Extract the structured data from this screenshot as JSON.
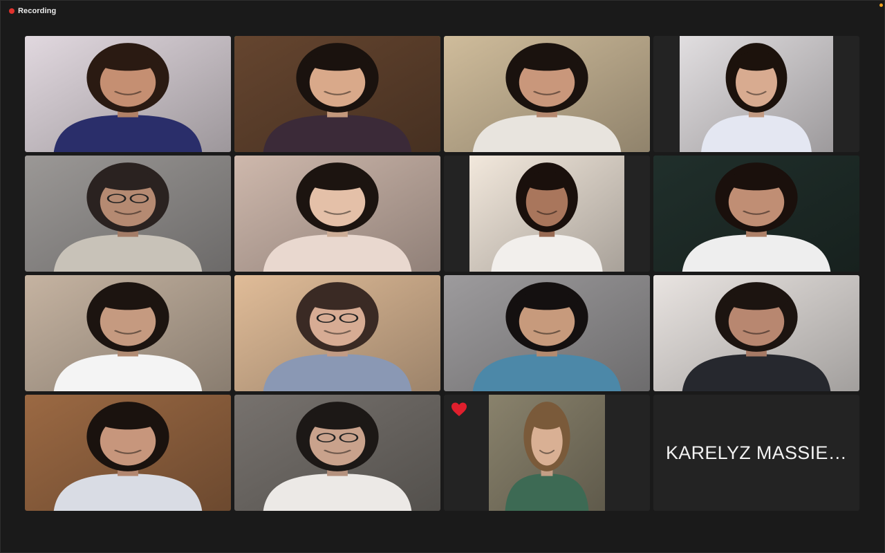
{
  "meeting": {
    "recording_label": "Recording",
    "recording_color": "#e0322d",
    "active_speaker_color": "#36c24a"
  },
  "participants": [
    {
      "video": true,
      "active": false,
      "bg": "#c9c1c7",
      "skin": "#c58f72",
      "hair": "#2a1a12",
      "shirt": "#2a2e6a",
      "glasses": false
    },
    {
      "video": true,
      "active": true,
      "bg": "#5a3e2a",
      "skin": "#d9a98a",
      "hair": "#1a120e",
      "shirt": "#3b2a38",
      "glasses": false
    },
    {
      "video": true,
      "active": false,
      "bg": "#b9a88a",
      "skin": "#c9977b",
      "hair": "#1a120e",
      "shirt": "#e8e4de",
      "glasses": false
    },
    {
      "video": true,
      "active": false,
      "bg": "#c9c6c8",
      "skin": "#d8ab90",
      "hair": "#1c120c",
      "shirt": "#e4e7f2",
      "glasses": false
    },
    {
      "video": true,
      "active": false,
      "bg": "#8a8886",
      "skin": "#b58a72",
      "hair": "#2a2220",
      "shirt": "#c8c2b8",
      "glasses": true
    },
    {
      "video": true,
      "active": false,
      "bg": "#b8a49a",
      "skin": "#e4c0a8",
      "hair": "#1c1410",
      "shirt": "#e9d8cf",
      "glasses": false
    },
    {
      "video": true,
      "active": false,
      "bg": "#d8cfc4",
      "skin": "#a9765c",
      "hair": "#1a100c",
      "shirt": "#f2efec",
      "glasses": false
    },
    {
      "video": true,
      "active": false,
      "bg": "#1d2a26",
      "skin": "#c08e74",
      "hair": "#1a100c",
      "shirt": "#eeeeee",
      "glasses": false
    },
    {
      "video": true,
      "active": false,
      "bg": "#b0a090",
      "skin": "#c59a80",
      "hair": "#1c1410",
      "shirt": "#f4f4f4",
      "glasses": false
    },
    {
      "video": true,
      "active": false,
      "bg": "#c8a888",
      "skin": "#d7ac94",
      "hair": "#3a2a24",
      "shirt": "#8a98b4",
      "glasses": true
    },
    {
      "video": true,
      "active": false,
      "bg": "#8c8a8c",
      "skin": "#c79a7c",
      "hair": "#141010",
      "shirt": "#4c88a8",
      "glasses": false
    },
    {
      "video": true,
      "active": false,
      "bg": "#d0ccc9",
      "skin": "#b88770",
      "hair": "#1c1410",
      "shirt": "#26282e",
      "glasses": false
    },
    {
      "video": true,
      "active": false,
      "bg": "#8a5e3c",
      "skin": "#c7967c",
      "hair": "#1a120e",
      "shirt": "#d9dce4",
      "glasses": false
    },
    {
      "video": true,
      "active": false,
      "bg": "#6a6662",
      "skin": "#c9a28c",
      "hair": "#1c1816",
      "shirt": "#ece9e6",
      "glasses": true
    },
    {
      "video": true,
      "active": false,
      "bg": "#7a7460",
      "skin": "#d9b094",
      "hair": "#7a5a3a",
      "shirt": "#3d6a54",
      "glasses": false,
      "reaction": "heart",
      "reaction_color": "#e01f2d"
    },
    {
      "video": false,
      "active": false,
      "name": "KARELYZ MASSIE…"
    }
  ]
}
